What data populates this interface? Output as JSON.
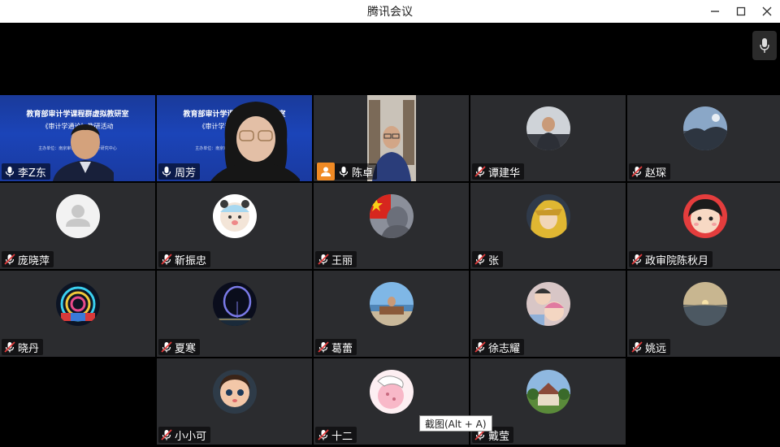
{
  "window": {
    "title": "腾讯会议"
  },
  "tooltip": "截图(Alt + A)",
  "colors": {
    "active_border": "#2fa75b",
    "host_badge": "#f08a24",
    "tile_bg": "#2b2c2f",
    "banner_blue": "#1b44b8"
  },
  "shared_screen": {
    "line1": "教育部审计学课程群虚拟教研室",
    "line2": "《审计学通论》教研活动",
    "line3": "主办单位：南京审计大学 国家审计研究中心"
  },
  "participants": [
    {
      "name": "李Z东",
      "muted": false,
      "kind": "video-screen-man"
    },
    {
      "name": "周芳",
      "muted": false,
      "kind": "video-screen-woman",
      "active": true
    },
    {
      "name": "陈卓",
      "muted": false,
      "kind": "video-man",
      "host": true
    },
    {
      "name": "谭建华",
      "muted": true,
      "kind": "avatar-office"
    },
    {
      "name": "赵琛",
      "muted": true,
      "kind": "avatar-landscape"
    },
    {
      "name": "庞晓萍",
      "muted": true,
      "kind": "avatar-default"
    },
    {
      "name": "靳振忠",
      "muted": true,
      "kind": "avatar-cartoon-bear"
    },
    {
      "name": "王丽",
      "muted": true,
      "kind": "avatar-flag"
    },
    {
      "name": "张",
      "muted": true,
      "kind": "avatar-anime"
    },
    {
      "name": "政审院陈秋月",
      "muted": true,
      "kind": "avatar-maruko"
    },
    {
      "name": "晓丹",
      "muted": true,
      "kind": "avatar-ferris"
    },
    {
      "name": "夏寒",
      "muted": true,
      "kind": "avatar-night-wheel"
    },
    {
      "name": "葛蕾",
      "muted": true,
      "kind": "avatar-sea"
    },
    {
      "name": "徐志耀",
      "muted": true,
      "kind": "avatar-kids"
    },
    {
      "name": "姚远",
      "muted": true,
      "kind": "avatar-sunset"
    },
    {
      "name": "小小可",
      "muted": true,
      "kind": "avatar-doll"
    },
    {
      "name": "十二",
      "muted": true,
      "kind": "avatar-pink-cartoon"
    },
    {
      "name": "戴莹",
      "muted": true,
      "kind": "avatar-house"
    }
  ]
}
